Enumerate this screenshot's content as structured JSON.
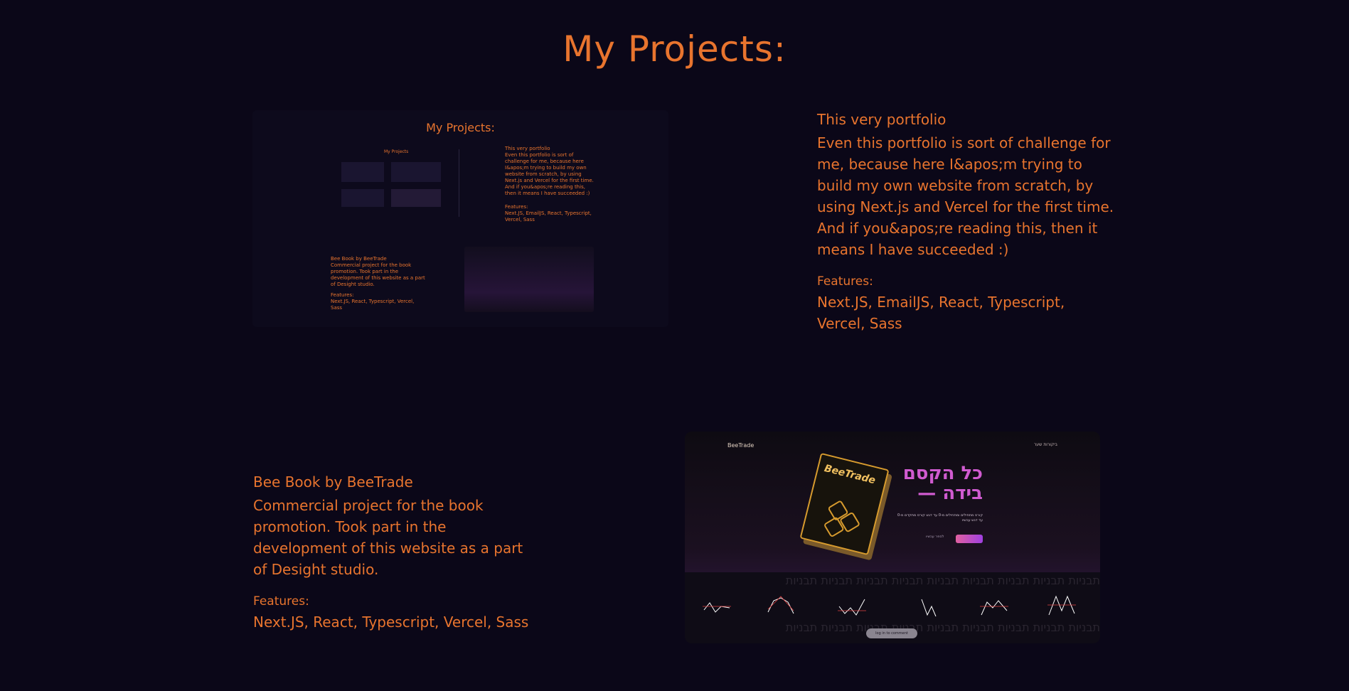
{
  "page": {
    "title": "My Projects:"
  },
  "projects": [
    {
      "title": "This very portfolio",
      "description": "Even this portfolio is sort of challenge for me, because here I&apos;m trying to build my own website from scratch, by using Next.js and Vercel for the first time. And if you&apos;re reading this, then it means I have succeeded :)",
      "features_label": "Features:",
      "features": "Next.JS, EmailJS, React, Typescript, Vercel, Sass"
    },
    {
      "title": "Bee Book by BeeTrade",
      "description": "Commercial project for the book promotion. Took part in the development of this website as a part of Desight studio.",
      "features_label": "Features:",
      "features": "Next.JS, React, Typescript, Vercel, Sass"
    }
  ],
  "thumb_portfolio": {
    "title": "My Projects:",
    "nested_title": "My Projects",
    "text1_title": "This very portfolio",
    "text1_desc": "Even this portfolio is sort of challenge for me, because here I&apos;m trying to build my own website from scratch, by using Next.js and Vercel for the first time. And if you&apos;re reading this, then it means I have succeeded :)",
    "text1_feat_label": "Features:",
    "text1_feat": "Next.JS, EmailJS, React, Typescript, Vercel, Sass",
    "text2_title": "Bee Book by BeeTrade",
    "text2_desc": "Commercial project for the book promotion. Took part in the development of this website as a part of Desight studio.",
    "text2_feat_label": "Features:",
    "text2_feat": "Next.JS, React, Typescript, Vercel, Sass"
  },
  "bee_shot": {
    "brand": "BeeTrade",
    "nav_links": "ביקורות      שער",
    "book_title": "BeeTrade",
    "headline_line1": "כל הקסם",
    "headline_line2": "בידה —",
    "subtext": "קורס מתחילים ומתחילים מ-0 עד דגש קורס מתקדם מ-0 עד דגש עכשיו",
    "secondary_cta": "לספר עכשיו",
    "strip_text": "תבניות  תבניות  תבניות  תבניות  תבניות  תבניות  תבניות  תבניות  תבניות",
    "toast": "log in to comment"
  },
  "colors": {
    "background": "#0b0718",
    "accent": "#e8742e"
  }
}
